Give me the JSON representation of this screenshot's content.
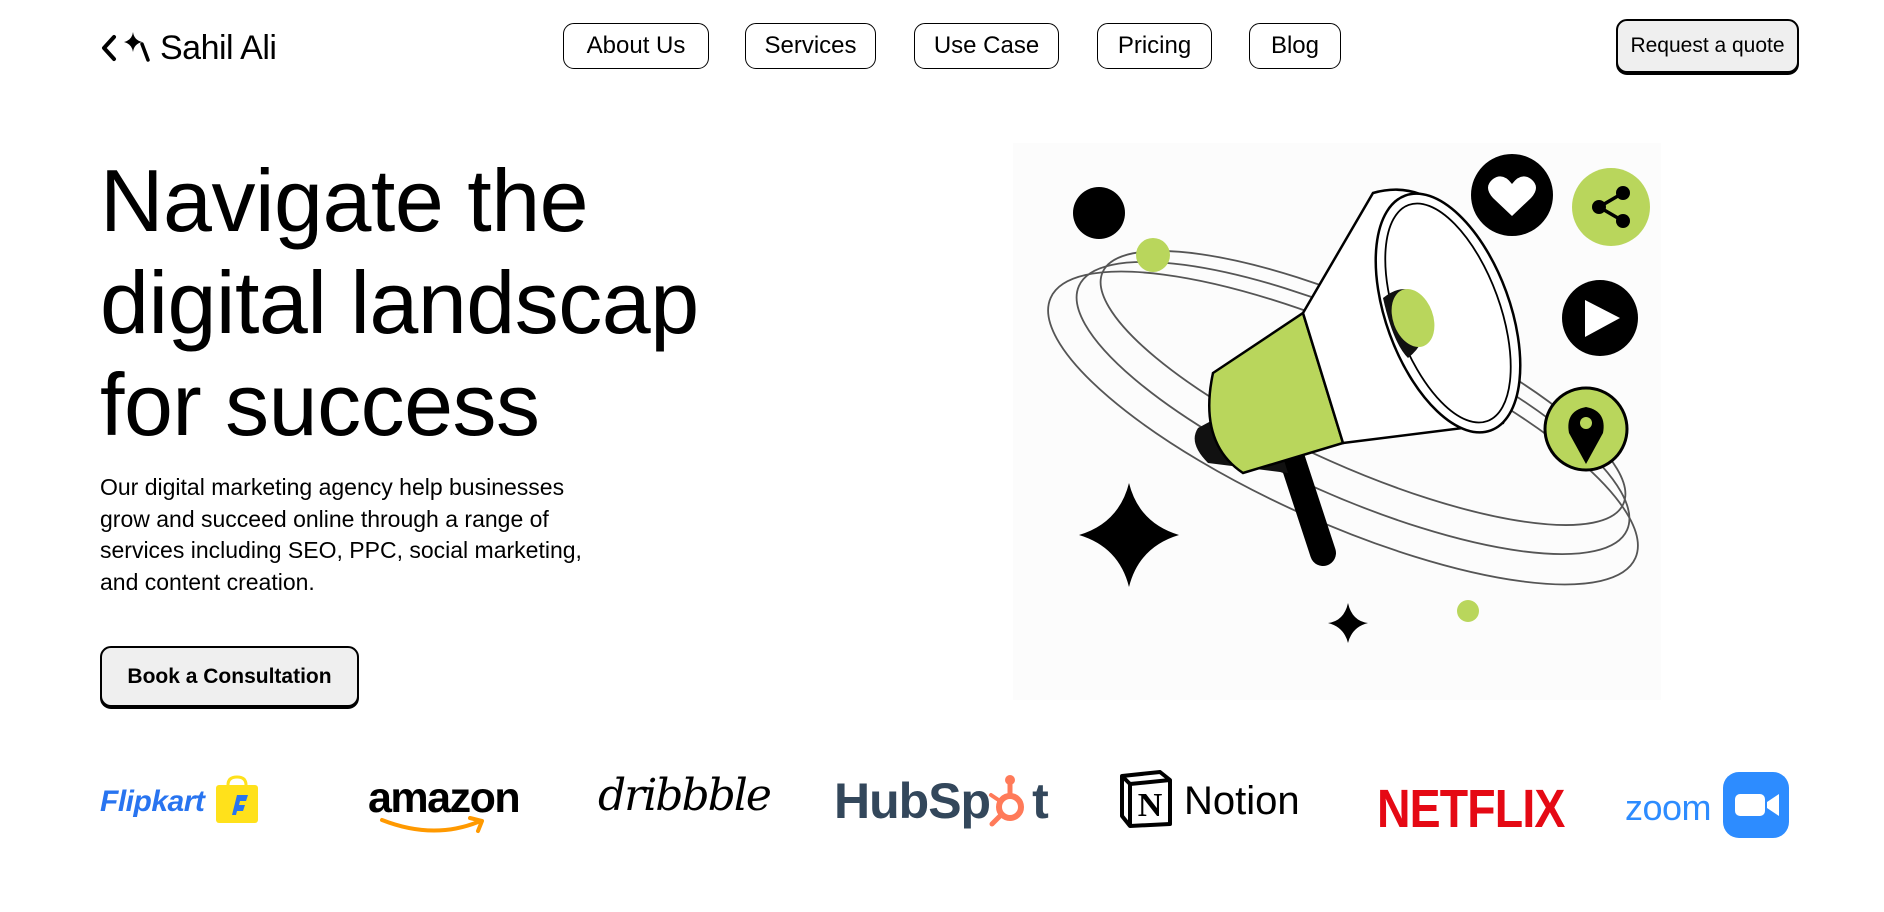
{
  "brand": {
    "name": "Sahil Ali"
  },
  "nav": {
    "items": [
      "About Us",
      "Services",
      "Use Case",
      "Pricing",
      "Blog"
    ]
  },
  "header": {
    "quote_button": "Request a quote"
  },
  "hero": {
    "title_lines": [
      "Navigate the",
      "digital landscap",
      "for success"
    ],
    "description": "Our digital marketing agency help businesses grow and succeed online through a range of services including SEO, PPC, social marketing, and content creation.",
    "cta_label": "Book a Consultation"
  },
  "partners": {
    "flipkart": "Flipkart",
    "amazon": "amazon",
    "dribbble": "dribbble",
    "hubspot_pre": "HubSp",
    "hubspot_post": "t",
    "notion": "Notion",
    "notion_icon_letter": "N",
    "netflix": "NETFLIX",
    "zoom": "zoom"
  },
  "colors": {
    "accent_green": "#b9d65c",
    "flipkart_blue": "#2874f0",
    "flipkart_yellow": "#ffe11b",
    "amazon_orange": "#ff9900",
    "hubspot_orange": "#ff7a59",
    "hubspot_slate": "#33475b",
    "netflix_red": "#e50914",
    "zoom_blue": "#2d8cff"
  },
  "icons": [
    "code-chevron-icon",
    "sparkle-icon",
    "megaphone-illustration",
    "heart-icon",
    "share-icon",
    "play-icon",
    "location-pin-icon",
    "star-sparkle-icon"
  ]
}
